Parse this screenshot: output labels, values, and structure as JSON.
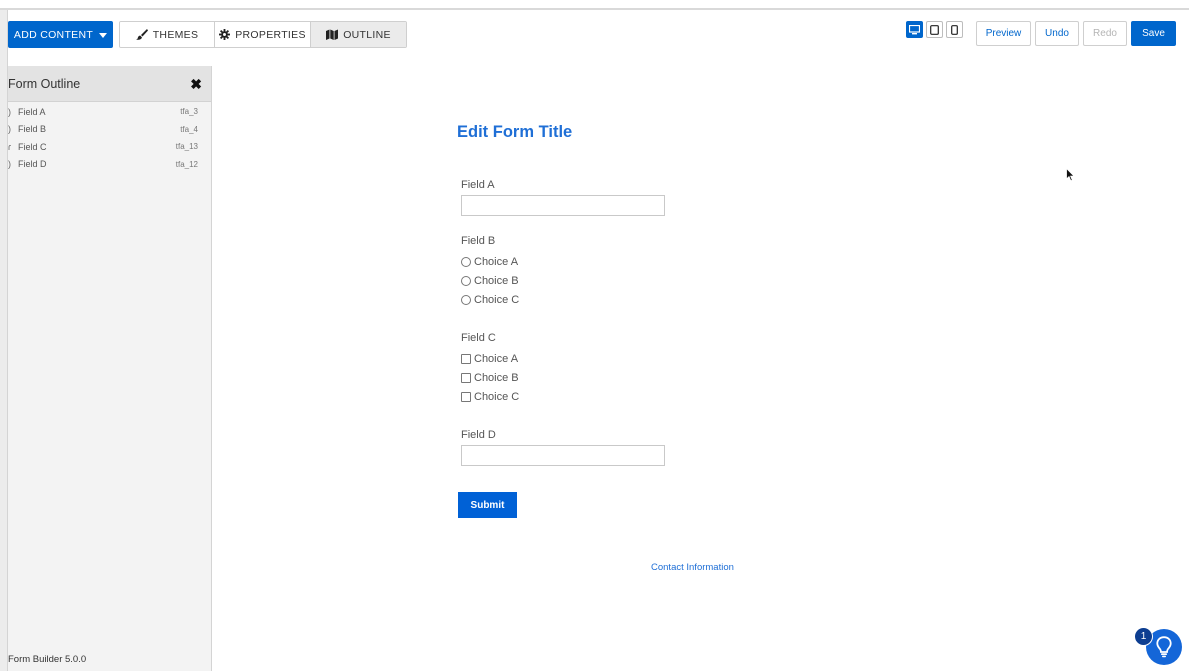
{
  "toolbar": {
    "add_content_label": "ADD CONTENT",
    "tabs": [
      {
        "label": "THEMES",
        "icon": "paintbrush-icon"
      },
      {
        "label": "PROPERTIES",
        "icon": "gear-icon"
      },
      {
        "label": "OUTLINE",
        "icon": "map-icon",
        "active": true
      }
    ],
    "devices": [
      {
        "icon": "desktop-icon",
        "active": true
      },
      {
        "icon": "tablet-icon",
        "active": false
      },
      {
        "icon": "phone-icon",
        "active": false
      }
    ],
    "preview_label": "Preview",
    "undo_label": "Undo",
    "redo_label": "Redo",
    "save_label": "Save"
  },
  "outline": {
    "title": "Form Outline",
    "items": [
      {
        "label": "Field A",
        "id": "tfa_3"
      },
      {
        "label": "Field B",
        "id": "tfa_4"
      },
      {
        "label": "Field C",
        "id": "tfa_13"
      },
      {
        "label": "Field D",
        "id": "tfa_12"
      }
    ],
    "version": "Form Builder 5.0.0"
  },
  "form": {
    "title": "Edit Form Title",
    "field_a": {
      "label": "Field A",
      "value": ""
    },
    "field_b": {
      "label": "Field B",
      "choices": [
        "Choice A",
        "Choice B",
        "Choice C"
      ]
    },
    "field_c": {
      "label": "Field C",
      "choices": [
        "Choice A",
        "Choice B",
        "Choice C"
      ]
    },
    "field_d": {
      "label": "Field D",
      "value": ""
    },
    "submit_label": "Submit",
    "contact_label": "Contact Information"
  },
  "help": {
    "badge": "1"
  },
  "colors": {
    "accent": "#0066cc",
    "title": "#1f6fd6"
  }
}
